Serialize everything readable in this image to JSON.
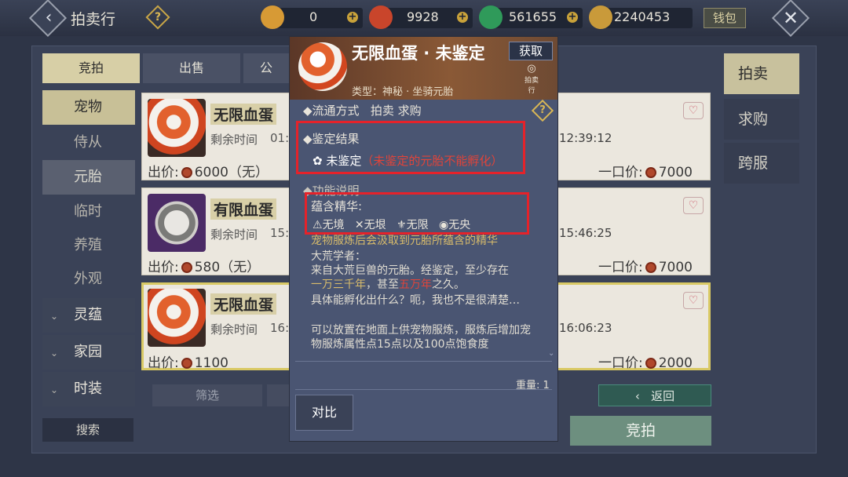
{
  "header": {
    "title": "拍卖行",
    "help": "?",
    "wallet_label": "钱包",
    "currencies": [
      {
        "name": "coin-a",
        "value": "0",
        "color": "#d79a35"
      },
      {
        "name": "coin-b",
        "value": "9928",
        "color": "#c9452b"
      },
      {
        "name": "coin-c",
        "value": "561655",
        "color": "#2f9a5a"
      },
      {
        "name": "coin-d",
        "value": "2240453",
        "color": "#c99a3a"
      }
    ]
  },
  "top_tabs": [
    "竞拍",
    "出售",
    "公"
  ],
  "left_nav": {
    "pet": "宠物",
    "attendant": "侍从",
    "embryo": "元胎",
    "temporary": "临时",
    "breeding": "养殖",
    "appearance": "外观",
    "spirit": "灵蕴",
    "home": "家园",
    "fashion": "时装"
  },
  "right_tabs": [
    "拍卖",
    "求购",
    "跨服"
  ],
  "cards": [
    {
      "name": "无限血蛋",
      "time_label": "剩余时间",
      "time_left": "01:",
      "price_label": "出价:",
      "price": "6000（无）",
      "right_time": "12:39:12",
      "buyout_label": "一口价:",
      "buyout": "7000"
    },
    {
      "name": "有限血蛋",
      "time_label": "剩余时间",
      "time_left": "15:",
      "price_label": "出价:",
      "price": "580（无）",
      "right_time": "15:46:25",
      "buyout_label": "一口价:",
      "buyout": "7000"
    },
    {
      "name": "无限血蛋",
      "time_label": "剩余时间",
      "time_left": "16:",
      "price_label": "出价:",
      "price": "1100",
      "right_time": "16:06:23",
      "buyout_label": "一口价:",
      "buyout": "2000"
    }
  ],
  "bottom": {
    "filter": "筛选",
    "search": "搜索",
    "back": "返回",
    "bid": "竞拍"
  },
  "popup": {
    "title": "无限血蛋 · 未鉴定",
    "get_button": "获取",
    "auction_icon_label": "拍卖行",
    "type": "类型：神秘 · 坐骑元胎",
    "circulation_label": "流通方式",
    "circulation_value": "拍卖 求购",
    "identify_title": "鉴定结果",
    "identify_status": "未鉴定",
    "identify_note": "（未鉴定的元胎不能孵化）",
    "function_title": "功能说明",
    "essence_title": "蕴含精华:",
    "essences": [
      "无境",
      "无垠",
      "无限",
      "无央"
    ],
    "desc_line1": "宠物服炼后会汲取到元胎所蕴含的精华",
    "desc_scholar": "大荒学者：",
    "desc_p1": "来自大荒巨兽的元胎。经鉴定，至少存在",
    "desc_gold1": "一万三千年",
    "desc_mid": "，甚至",
    "desc_red1": "五万年",
    "desc_end1": "之久。",
    "desc_p2": "具体能孵化出什么？呃，我也不是很清楚…",
    "desc_p3": "可以放置在地面上供宠物服炼，服炼后增加宠物服炼属性点15点以及100点饱食度",
    "weight": "重量: 1",
    "compare": "对比"
  }
}
